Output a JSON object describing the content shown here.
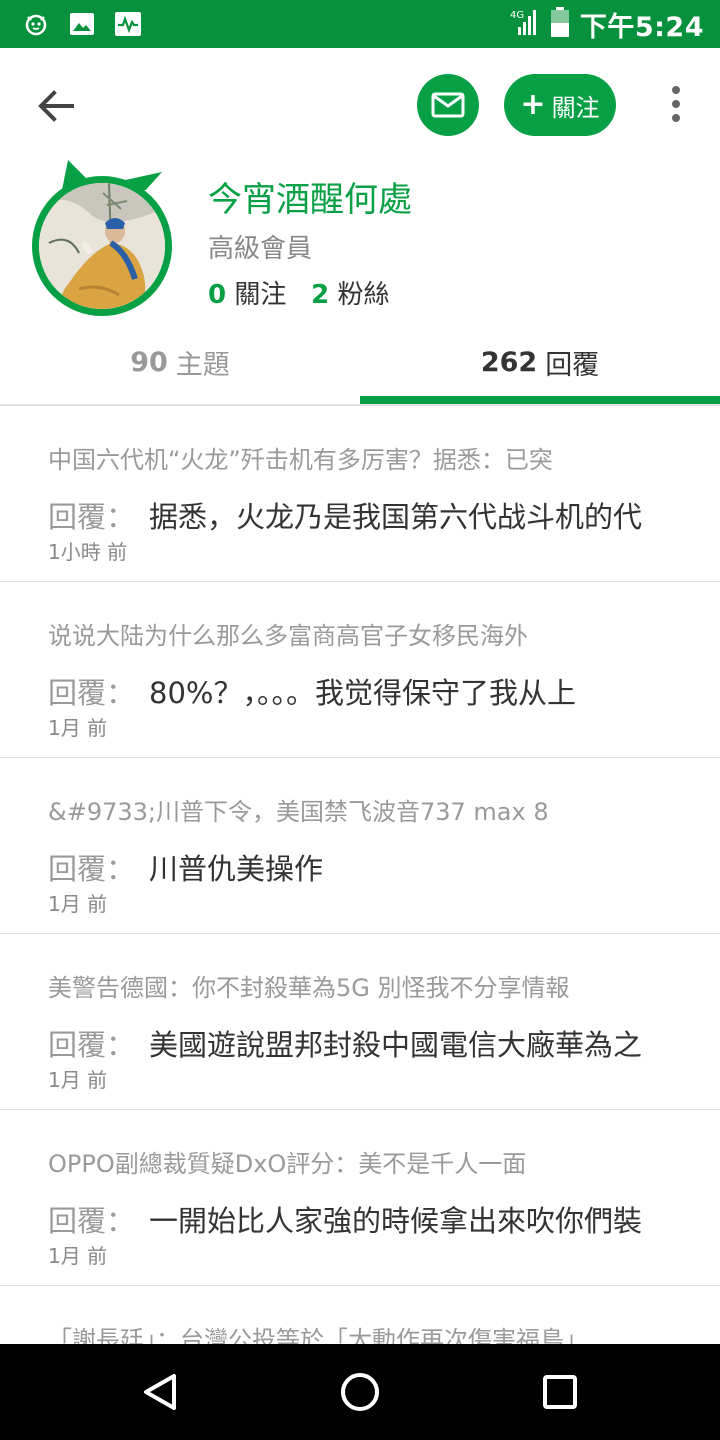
{
  "status_bar": {
    "time": "下午5:24",
    "network": "4G",
    "icons": [
      "cat-face-icon",
      "image-icon",
      "activity-icon",
      "signal-icon",
      "battery-icon"
    ],
    "background": "#08913c"
  },
  "header": {
    "follow_label": "關注",
    "accent": "#08a045"
  },
  "profile": {
    "name": "今宵酒醒何處",
    "level": "高級會員",
    "following_count": "0",
    "following_label": "關注",
    "followers_count": "2",
    "followers_label": "粉絲"
  },
  "tabs": [
    {
      "count": "90",
      "label": "主題",
      "active": false
    },
    {
      "count": "262",
      "label": "回覆",
      "active": true
    }
  ],
  "reply_label": "回覆：",
  "items": [
    {
      "title": "中国六代机“火龙”歼击机有多厉害？据悉：已突",
      "reply": "据悉，火龙乃是我国第六代战斗机的代",
      "time": "1小時 前"
    },
    {
      "title": "说说大陆为什么那么多富商高官子女移民海外",
      "reply": "80%？，。。。我觉得保守了我从上",
      "time": "1月 前"
    },
    {
      "title": "&#9733;川普下令，美国禁飞波音737 max 8",
      "reply": "川普仇美操作",
      "time": "1月 前"
    },
    {
      "title": "美警告德國：你不封殺華為5G 別怪我不分享情報",
      "reply": "美國遊說盟邦封殺中國電信大廠華為之",
      "time": "1月 前"
    },
    {
      "title": "OPPO副總裁質疑DxO評分：美不是千人一面",
      "reply": "一開始比人家強的時候拿出來吹你們裝",
      "time": "1月 前"
    }
  ],
  "partial_item": {
    "title": "「謝長廷」：台灣公投等於「大動作再次傷害福島」"
  }
}
